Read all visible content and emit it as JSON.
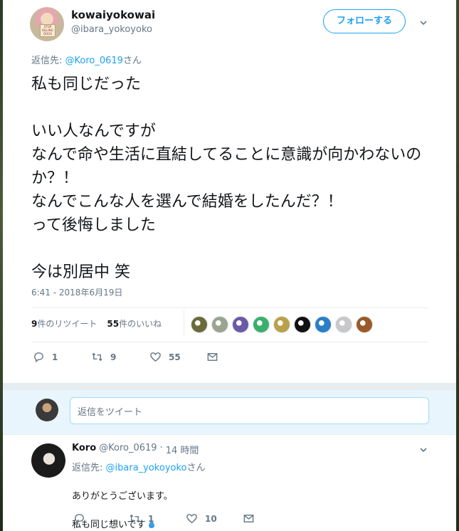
{
  "tweet": {
    "author_name": "kowaiyokowai",
    "author_handle": "@ibara_yokoyoko",
    "avatar_sign_text": "STOP KILLING DOGS",
    "follow_label": "フォローする",
    "reply_to_prefix": "返信先: ",
    "reply_to_mention": "@Koro_0619",
    "reply_to_suffix": "さん",
    "text": "私も同じだった\n\nいい人なんですが\nなんで命や生活に直結してることに意識が向かわないのか？！\nなんでこんな人を選んで結婚をしたんだ？！\nって後悔しました\n\n今は別居中 笑",
    "timestamp": "6:41 - 2018年6月19日",
    "retweets_count": "9",
    "retweets_label": "件のリツイート",
    "likes_count": "55",
    "likes_label": "件のいいね",
    "likers": [
      {
        "color": "#6b6b3a"
      },
      {
        "color": "#9aa48e"
      },
      {
        "color": "#6a5aa8"
      },
      {
        "color": "#3ab06a"
      },
      {
        "color": "#b9a04a"
      },
      {
        "color": "#111111"
      },
      {
        "color": "#2a7ec8"
      },
      {
        "color": "#c8c8c8"
      },
      {
        "color": "#9a5a2a"
      }
    ],
    "actions": {
      "replies": "1",
      "retweets": "9",
      "likes": "55"
    }
  },
  "reply_box": {
    "placeholder": "返信をツイート"
  },
  "reply": {
    "author_name": "Koro",
    "author_handle": "@Koro_0619",
    "dot": "·",
    "time": "14 時間",
    "reply_to_prefix": "返信先: ",
    "reply_to_mention": "@ibara_yokoyoko",
    "reply_to_suffix": "さん",
    "text_line1": "ありがとうございます。",
    "text_line2": "私も同じ想いです",
    "actions": {
      "replies": "",
      "retweets": "1",
      "likes": "10"
    }
  },
  "colors": {
    "accent": "#1da1f2",
    "muted": "#657786",
    "border": "#e6ecf0"
  }
}
